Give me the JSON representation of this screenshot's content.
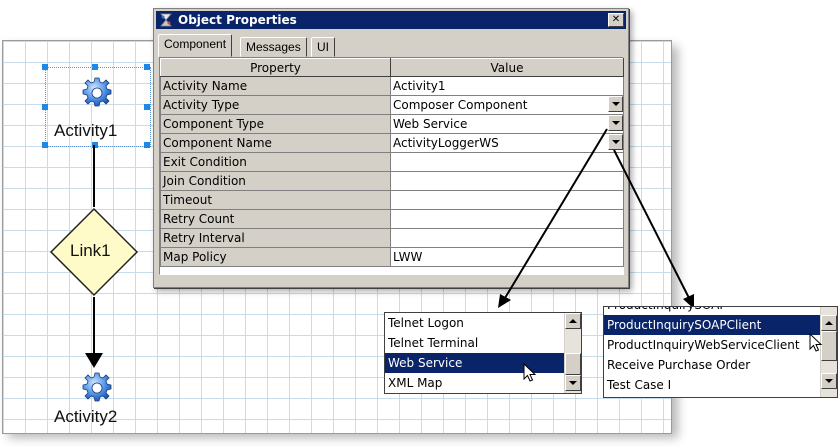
{
  "canvas": {
    "nodes": [
      {
        "label": "Activity1",
        "icon": "gear-icon"
      },
      {
        "label": "Link1"
      },
      {
        "label": "Activity2",
        "icon": "gear-icon"
      }
    ]
  },
  "dialog": {
    "title": "Object Properties",
    "title_icon": "properties-icon",
    "close_glyph": "✕",
    "tabs": [
      {
        "label": "Component",
        "active": true
      },
      {
        "label": "Messages",
        "active": false
      },
      {
        "label": "UI",
        "active": false
      }
    ],
    "columns": [
      "Property",
      "Value"
    ],
    "rows": [
      {
        "property": "Activity Name",
        "value": "Activity1",
        "dropdown": false
      },
      {
        "property": "Activity Type",
        "value": "Composer Component",
        "dropdown": true
      },
      {
        "property": "Component Type",
        "value": "Web Service",
        "dropdown": true
      },
      {
        "property": "Component Name",
        "value": "ActivityLoggerWS",
        "dropdown": true
      },
      {
        "property": "Exit Condition",
        "value": "",
        "dropdown": false
      },
      {
        "property": "Join Condition",
        "value": "",
        "dropdown": false
      },
      {
        "property": "Timeout",
        "value": "",
        "dropdown": false
      },
      {
        "property": "Retry Count",
        "value": "",
        "dropdown": false
      },
      {
        "property": "Retry Interval",
        "value": "",
        "dropdown": false
      },
      {
        "property": "Map Policy",
        "value": "LWW",
        "dropdown": false
      }
    ]
  },
  "component_type_list": {
    "items": [
      "Telnet Logon",
      "Telnet Terminal",
      "Web Service",
      "XML Map"
    ],
    "selected": "Web Service"
  },
  "component_name_list": {
    "items": [
      "ProductInquirySOAP",
      "ProductInquirySOAPClient",
      "ProductInquiryWebServiceClient",
      "Receive Purchase Order",
      "Test Case I"
    ],
    "selected": "ProductInquirySOAPClient"
  },
  "colors": {
    "selection": "#0a246a",
    "dialog_face": "#d4d0c8",
    "link_diamond": "#fffbc8",
    "grid": "#c7dbe8",
    "handle": "#1e88e5"
  }
}
